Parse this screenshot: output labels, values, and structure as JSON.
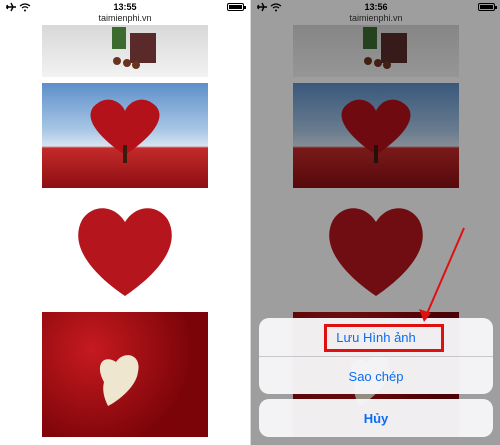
{
  "screens": [
    {
      "time": "13:55",
      "url": "taimienphi.vn"
    },
    {
      "time": "13:56",
      "url": "taimienphi.vn",
      "action_sheet": {
        "save_image": "Lưu Hình ảnh",
        "copy": "Sao chép",
        "cancel": "Hủy"
      }
    }
  ],
  "icons": {
    "statusbar": [
      "airplane-icon",
      "wifi-icon",
      "battery-icon"
    ],
    "annotation": "red-arrow-icon"
  },
  "colors": {
    "action_text": "#0a6cf5",
    "highlight": "#e01010"
  }
}
